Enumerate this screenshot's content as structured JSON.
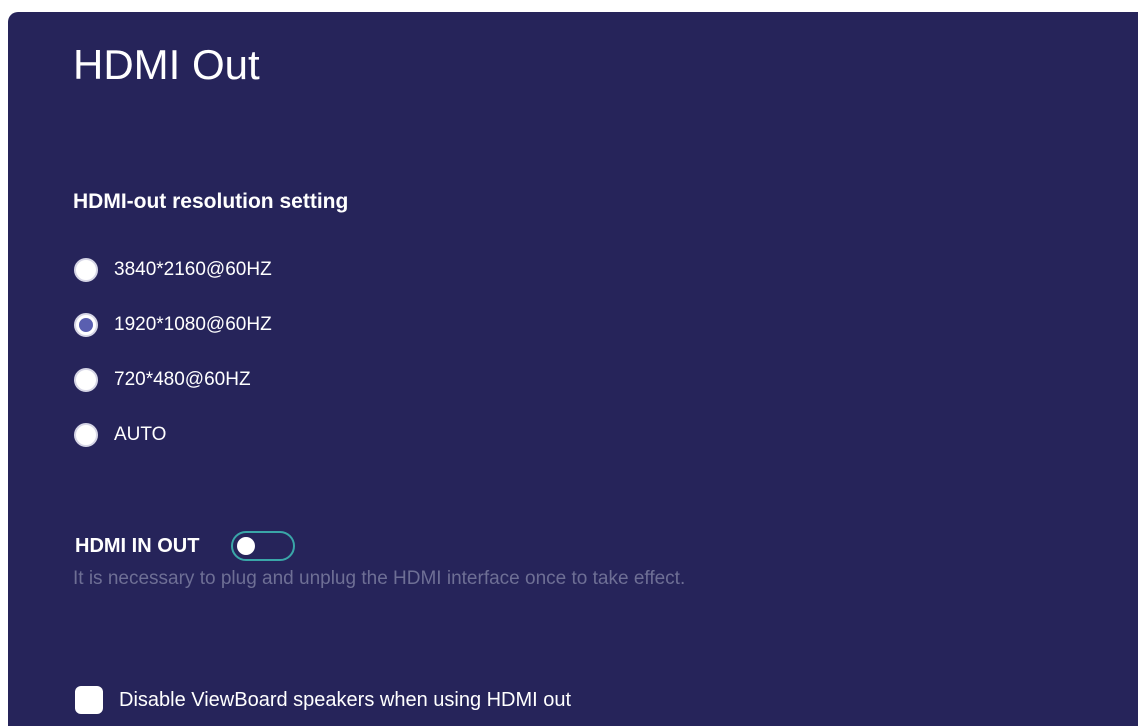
{
  "page": {
    "title": "HDMI Out"
  },
  "resolution": {
    "heading": "HDMI-out resolution setting",
    "options": [
      {
        "label": "3840*2160@60HZ",
        "selected": false
      },
      {
        "label": "1920*1080@60HZ",
        "selected": true
      },
      {
        "label": "720*480@60HZ",
        "selected": false
      },
      {
        "label": "AUTO",
        "selected": false
      }
    ],
    "selected_value": "1920*1080@60HZ"
  },
  "hdmi_in_out": {
    "label": "HDMI IN OUT",
    "enabled": false,
    "hint": "It is necessary to plug and unplug the HDMI interface once to take effect."
  },
  "speakers": {
    "label": "Disable ViewBoard speakers when using HDMI out",
    "checked": false
  },
  "colors": {
    "panel_background": "#26245a",
    "radio_selected": "#5a5fb0",
    "toggle_border": "#3aa6a8",
    "hint_text": "#6e6f95"
  }
}
